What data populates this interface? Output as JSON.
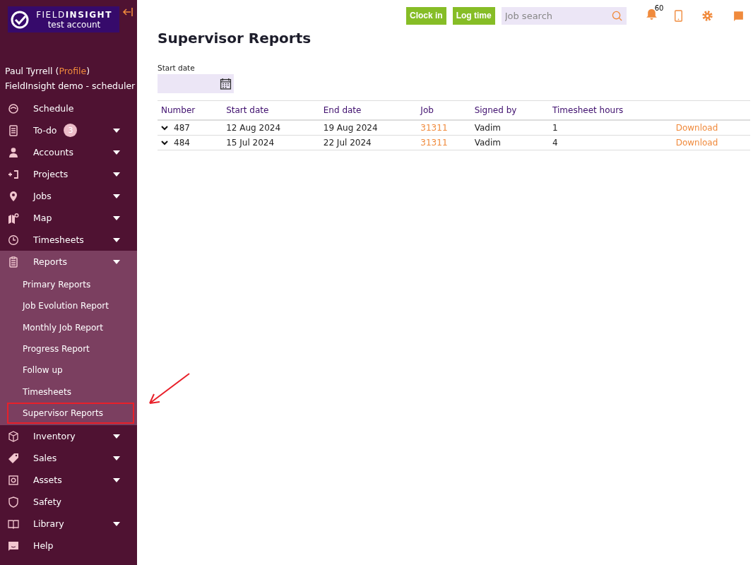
{
  "sidebar": {
    "logo": {
      "brand_light": "FIELD",
      "brand_bold": "INSIGHT",
      "account": "test account"
    },
    "user": {
      "name": "Paul Tyrrell (",
      "profile_link": "Profile",
      "name_end": ")",
      "company": "FieldInsight demo - scheduler"
    },
    "items": [
      {
        "label": "Schedule",
        "expandable": false
      },
      {
        "label": "To-do",
        "expandable": true,
        "badge": "3"
      },
      {
        "label": "Accounts",
        "expandable": true
      },
      {
        "label": "Projects",
        "expandable": true
      },
      {
        "label": "Jobs",
        "expandable": true
      },
      {
        "label": "Map",
        "expandable": true
      },
      {
        "label": "Timesheets",
        "expandable": true
      },
      {
        "label": "Reports",
        "expandable": true,
        "expanded": true,
        "children": [
          {
            "label": "Primary Reports",
            "selected": false
          },
          {
            "label": "Job Evolution Report",
            "selected": false
          },
          {
            "label": "Monthly Job Report",
            "selected": false
          },
          {
            "label": "Progress Report",
            "selected": false
          },
          {
            "label": "Follow up",
            "selected": false
          },
          {
            "label": "Timesheets",
            "selected": false
          },
          {
            "label": "Supervisor Reports",
            "selected": true
          }
        ]
      },
      {
        "label": "Inventory",
        "expandable": true
      },
      {
        "label": "Sales",
        "expandable": true
      },
      {
        "label": "Assets",
        "expandable": true
      },
      {
        "label": "Safety",
        "expandable": false
      },
      {
        "label": "Library",
        "expandable": true
      },
      {
        "label": "Help",
        "expandable": false
      }
    ]
  },
  "topbar": {
    "buttons": [
      "Clock in",
      "Log time"
    ],
    "search": {
      "placeholder": "Job search"
    },
    "notifications": "60"
  },
  "page": {
    "title": "Supervisor Reports",
    "filter": {
      "label": "Start date"
    },
    "table": {
      "columns": [
        "Number",
        "Start date",
        "End date",
        "Job",
        "Signed by",
        "Timesheet hours"
      ],
      "rows": [
        {
          "number": "487",
          "start": "12 Aug 2024",
          "end": "19 Aug 2024",
          "job": "31311",
          "signed_by": "Vadim",
          "hours": "1",
          "action": "Download"
        },
        {
          "number": "484",
          "start": "15 Jul 2024",
          "end": "22 Jul 2024",
          "job": "31311",
          "signed_by": "Vadim",
          "hours": "4",
          "action": "Download"
        }
      ]
    }
  }
}
